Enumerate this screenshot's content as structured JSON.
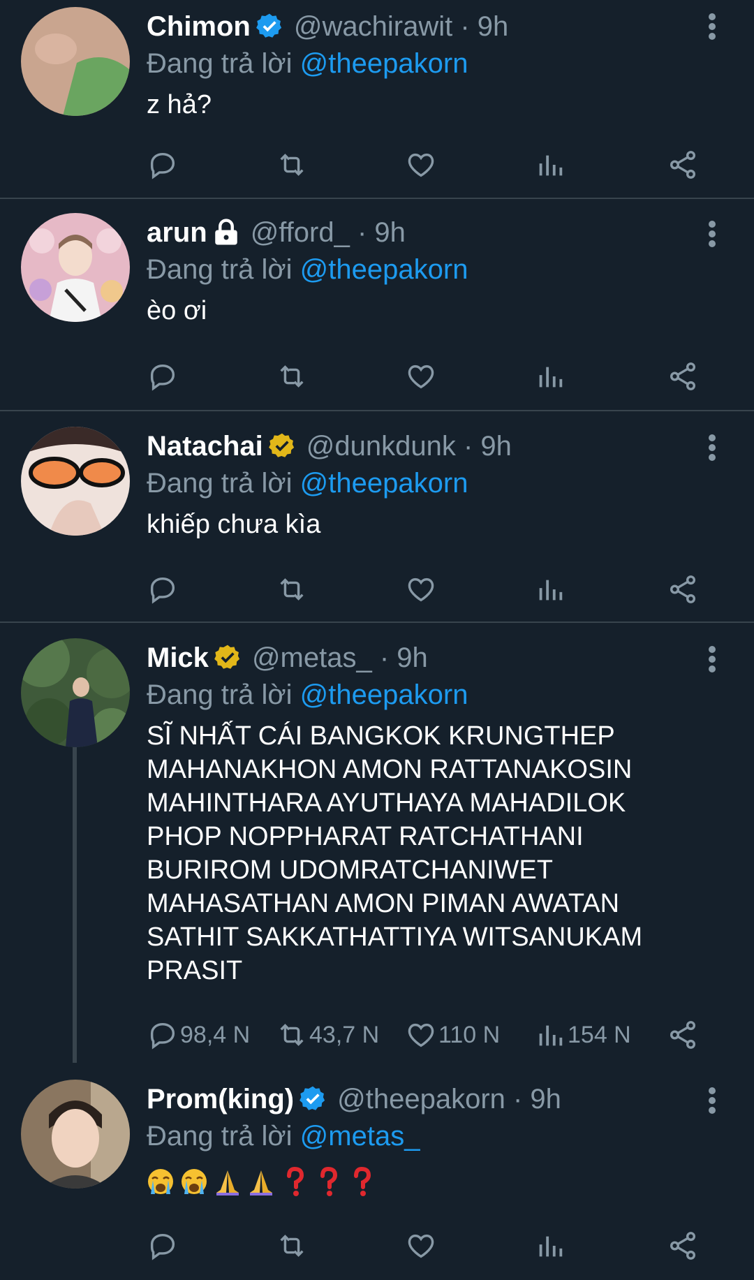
{
  "replying_label": "Đang trả lời",
  "tweets": [
    {
      "name": "Chimon",
      "badge": "verified-blue",
      "handle": "@wachirawit · 9h",
      "reply_to": "@theepakorn",
      "text": "z hả?",
      "avatar_color": "#5a7a4a"
    },
    {
      "name": "arun",
      "badge": "lock",
      "handle": "@fford_ · 9h",
      "reply_to": "@theepakorn",
      "text": "èo ơi",
      "avatar_color": "#d8a6b8"
    },
    {
      "name": "Natachai",
      "badge": "verified-gold",
      "handle": "@dunkdunk · 9h",
      "reply_to": "@theepakorn",
      "text": "khiếp chưa kìa",
      "avatar_color": "#e8c8c0"
    },
    {
      "name": "Mick",
      "badge": "verified-gold",
      "handle": "@metas_ · 9h",
      "reply_to": "@theepakorn",
      "lines": [
        "SĨ NHẤT CÁI BANGKOK KRUNGTHEP",
        "MAHANAKHON AMON RATTANAKOSIN",
        "MAHINTHARA AYUTHAYA MAHADILOK",
        "PHOP NOPPHARAT RATCHATHANI",
        "BURIROM UDOMRATCHANIWET",
        "MAHASATHAN AMON PIMAN AWATAN",
        "SATHIT SAKKATHATTIYA WITSANUKAM",
        "PRASIT"
      ],
      "stats": {
        "replies": "98,4 N",
        "retweets": "43,7 N",
        "likes": "110 N",
        "views": "154 N"
      },
      "avatar_color": "#4e6e44"
    },
    {
      "name": "Prom(king)",
      "badge": "verified-blue",
      "handle": "@theepakorn · 9h",
      "reply_to": "@metas_",
      "emoji_text": "😭😭🙏🙏❓❓❓",
      "avatar_color": "#7a6650"
    }
  ],
  "colors": {
    "background": "#15202b",
    "muted": "#8899a6",
    "link": "#1d9bf0",
    "divider": "#38444d",
    "gold": "#e2b719"
  }
}
